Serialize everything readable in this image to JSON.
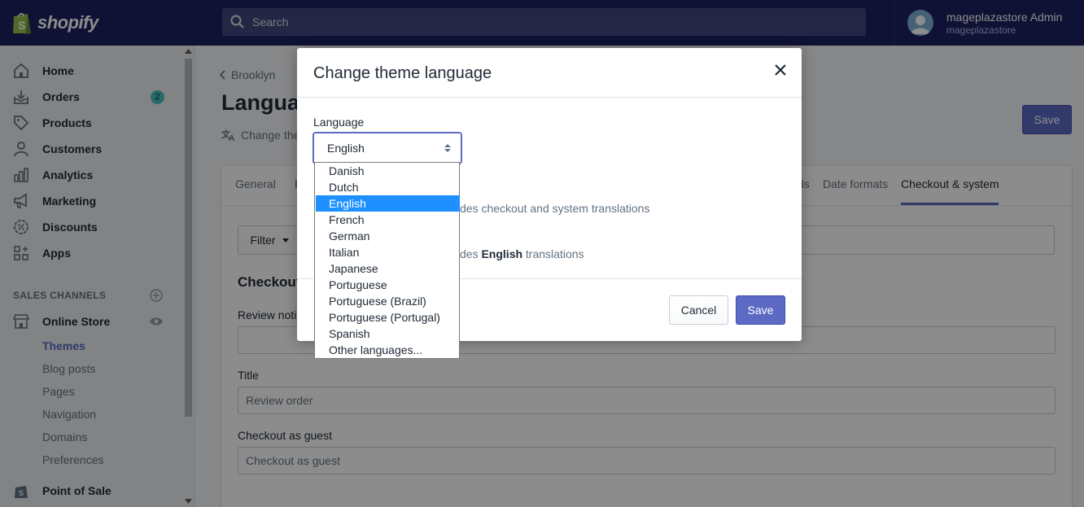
{
  "app": {
    "logo_text": "shopify"
  },
  "search": {
    "placeholder": "Search"
  },
  "user": {
    "name": "mageplazastore Admin",
    "store": "mageplazastore"
  },
  "sidebar": {
    "items": [
      {
        "label": "Home",
        "icon": "home-icon"
      },
      {
        "label": "Orders",
        "icon": "orders-icon",
        "badge": "2"
      },
      {
        "label": "Products",
        "icon": "tag-icon"
      },
      {
        "label": "Customers",
        "icon": "customer-icon"
      },
      {
        "label": "Analytics",
        "icon": "analytics-icon"
      },
      {
        "label": "Marketing",
        "icon": "megaphone-icon"
      },
      {
        "label": "Discounts",
        "icon": "discount-icon"
      },
      {
        "label": "Apps",
        "icon": "apps-icon"
      }
    ],
    "sales_channels_title": "SALES CHANNELS",
    "online_store": "Online Store",
    "sub_items": [
      "Themes",
      "Blog posts",
      "Pages",
      "Navigation",
      "Domains",
      "Preferences"
    ],
    "point_of_sale": "Point of Sale"
  },
  "main": {
    "breadcrumb": "Brooklyn",
    "title": "Langua",
    "subtitle": "Change the",
    "save": "Save",
    "tabs": [
      "General",
      "E",
      "ds",
      "Date formats",
      "Checkout & system"
    ],
    "active_tab": "Checkout & system",
    "filter": "Filter",
    "section": "Checkout",
    "fields": [
      {
        "label": "Review notic",
        "value": ""
      },
      {
        "label": "Title",
        "value": "Review order"
      },
      {
        "label": "Checkout as guest",
        "value": "Checkout as guest"
      }
    ]
  },
  "modal": {
    "title": "Change theme language",
    "language_label": "Language",
    "selected": "English",
    "options": [
      "Danish",
      "Dutch",
      "English",
      "French",
      "German",
      "Italian",
      "Japanese",
      "Portuguese",
      "Portuguese (Brazil)",
      "Portuguese (Portugal)",
      "Spanish",
      "Other languages..."
    ],
    "text1": "des checkout and system translations",
    "text2_pre": "des ",
    "text2_bold": "English",
    "text2_post": " translations",
    "cancel": "Cancel",
    "save": "Save"
  },
  "colors": {
    "topbar": "#1c2260",
    "accent": "#5c6ac4",
    "badge": "#47c1bf",
    "selected_option": "#1e90ff"
  }
}
